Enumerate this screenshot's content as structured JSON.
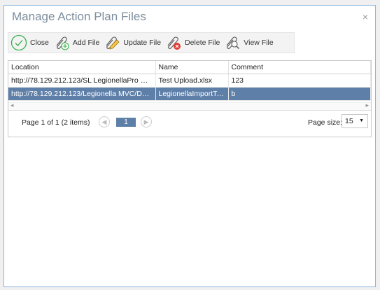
{
  "dialog": {
    "title": "Manage Action Plan Files",
    "close_glyph": "×"
  },
  "toolbar": {
    "close_label": "Close",
    "add_label": "Add File",
    "update_label": "Update File",
    "delete_label": "Delete File",
    "view_label": "View File"
  },
  "grid": {
    "columns": [
      "Location",
      "Name",
      "Comment"
    ],
    "rows": [
      {
        "location": "http://78.129.212.123/SL LegionellaPro V1/Fi...",
        "name": "Test Upload.xlsx",
        "comment": "123",
        "selected": false
      },
      {
        "location": "http://78.129.212.123/Legionella MVC/Docu...",
        "name": "LegionellaImportTe...",
        "comment": "b",
        "selected": true
      }
    ]
  },
  "pager": {
    "info": "Page 1 of 1 (2 items)",
    "current_page": "1",
    "page_size_label": "Page size:",
    "page_size": "15",
    "prev_icon": "◀",
    "next_icon": "▶"
  },
  "colors": {
    "accent": "#5e7fa8",
    "border": "#8ab4dc",
    "close_icon": "#35b04a",
    "delete_icon": "#e53935"
  }
}
